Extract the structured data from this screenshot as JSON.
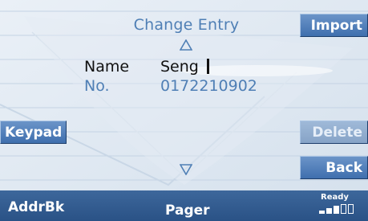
{
  "screen": {
    "title": "Change Entry",
    "fields": [
      {
        "label": "Name",
        "value": "Seng",
        "active": true
      },
      {
        "label": "No.",
        "value": "0172210902",
        "active": false
      }
    ]
  },
  "softkeys": {
    "import": "Import",
    "keypad": "Keypad",
    "delete": "Delete",
    "back": "Back"
  },
  "statusbar": {
    "tab_left": "AddrBk",
    "tab_center": "Pager",
    "ready": "Ready",
    "signal_level": 3,
    "signal_max": 5
  },
  "colors": {
    "accent_blue": "#4f7fb5",
    "softkey_blue": "#4a7ab7",
    "statusbar_blue": "#2f5a90",
    "background": "#dfe8f1"
  }
}
